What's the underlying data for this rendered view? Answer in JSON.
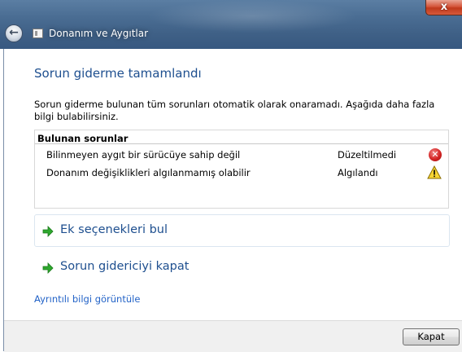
{
  "window": {
    "title": "Donanım ve Aygıtlar",
    "close_glyph": "x",
    "back_glyph": "←"
  },
  "content": {
    "heading": "Sorun giderme tamamlandı",
    "description": "Sorun giderme bulunan tüm sorunları otomatik olarak onaramadı. Aşağıda daha fazla bilgi bulabilirsiniz."
  },
  "problems": {
    "header": "Bulunan sorunlar",
    "rows": [
      {
        "name": "Bilinmeyen aygıt bir sürücüye sahip değil",
        "status": "Düzeltilmedi",
        "icon": "error-icon"
      },
      {
        "name": "Donanım değişiklikleri algılanmamış olabilir",
        "status": "Algılandı",
        "icon": "warning-icon"
      }
    ]
  },
  "options": {
    "find_more": "Ek seçenekleri bul",
    "close_troubleshooter": "Sorun gidericiyi kapat"
  },
  "details_link": "Ayrıntılı bilgi görüntüle",
  "footer": {
    "close_button": "Kapat"
  },
  "colors": {
    "heading": "#1e4f8f",
    "link": "#2363c7",
    "arrow_green": "#2ea82e"
  }
}
